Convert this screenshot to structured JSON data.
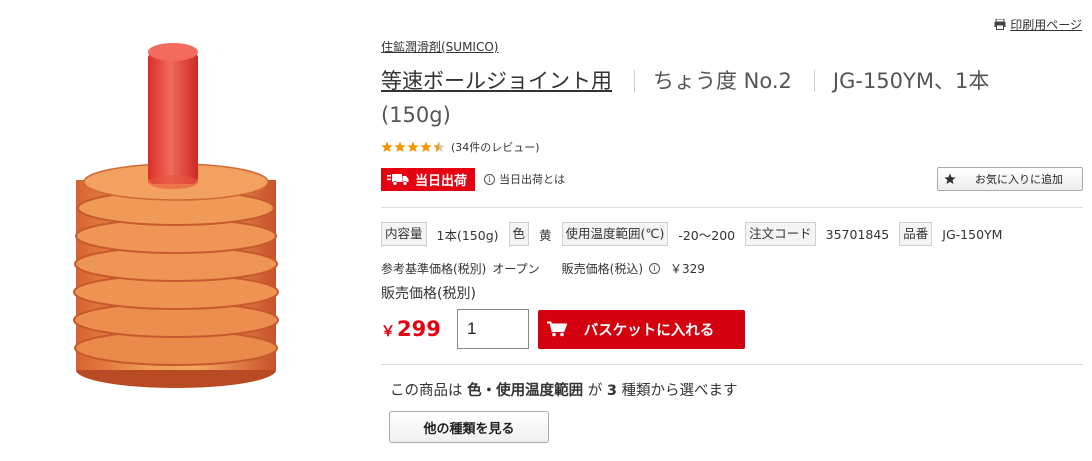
{
  "header": {
    "print_label": "印刷用ページ",
    "print_icon": "printer-icon"
  },
  "product": {
    "brand": "住鉱潤滑剤(SUMICO)",
    "title_main": "等速ボールジョイント用",
    "title_grade": "ちょう度 No.2",
    "title_model": "JG-150YM、1本",
    "title_qty": "(150g)",
    "rating": 4.5,
    "review_text": "(34件のレビュー)",
    "star_color": "#f39800"
  },
  "shipping": {
    "badge": "当日出荷",
    "info": "当日出荷とは",
    "badge_color": "#e50012"
  },
  "favorite": {
    "label": "お気に入りに追加",
    "icon": "star-icon"
  },
  "specs": [
    {
      "key": "内容量",
      "value": "1本(150g)"
    },
    {
      "key": "色",
      "value": "黄"
    },
    {
      "key": "使用温度範囲(℃)",
      "value": "-20～200"
    },
    {
      "key": "注文コード",
      "value": "35701845"
    },
    {
      "key": "品番",
      "value": "JG-150YM"
    }
  ],
  "pricing": {
    "ref_label": "参考基準価格(税別)",
    "ref_value": "オープン",
    "tax_in_label": "販売価格(税込)",
    "tax_in_value": "￥329",
    "sale_label": "販売価格(税別)",
    "currency": "￥",
    "sale_price": "299"
  },
  "cart": {
    "quantity": "1",
    "button_label": "バスケットに入れる",
    "button_color": "#d40010"
  },
  "variants": {
    "prefix": "この商品は",
    "attrs": "色・使用温度範囲",
    "middle": "が",
    "count": "3",
    "suffix": "種類から選べます",
    "button_label": "他の種類を見る"
  }
}
